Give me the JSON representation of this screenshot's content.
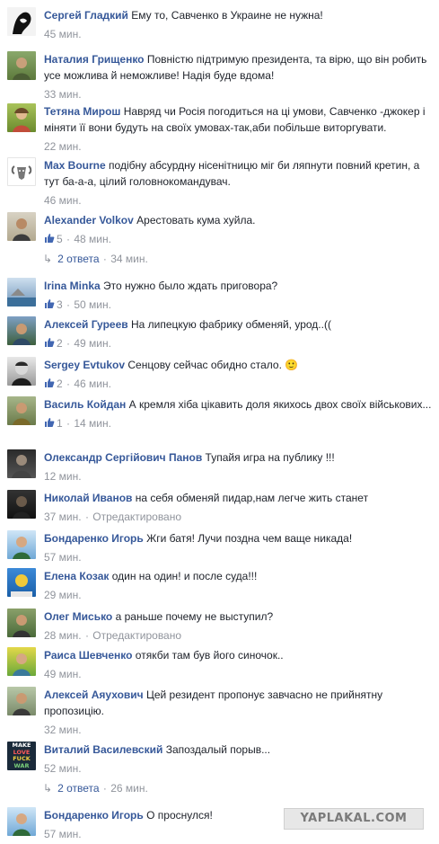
{
  "comments": [
    {
      "author": "Сергей Гладкий",
      "text": "Ему то, Савченко в Украине не нужна!",
      "time": "45 мин.",
      "likes": "",
      "edited": ""
    },
    {
      "author": "Наталия Грищенко",
      "text": "Повністю підтримую президента, та вірю, що він робить усе можлива й неможливе! Надія буде вдома!",
      "time": "33 мин.",
      "likes": "",
      "edited": ""
    },
    {
      "author": "Тетяна Мирош",
      "text": "Навряд чи Росія погодиться на ці умови, Савченко -джокер і міняти її вони будуть на своїх умовах-так,аби побільше виторгувати.",
      "time": "22 мин.",
      "likes": "",
      "edited": ""
    },
    {
      "author": "Max Bourne",
      "text": "подібну абсурдну нісенітницю міг би ляпнути повний кретин, а тут ба-а-а, цілий головнокомандувач.",
      "time": "46 мин.",
      "likes": "",
      "edited": ""
    },
    {
      "author": "Alexander Volkov",
      "text": "Арестовать кума хуйла.",
      "time": "48 мин.",
      "likes": "5",
      "edited": ""
    },
    {
      "author": "Irina Minka",
      "text": "Это нужно было ждать приговора?",
      "time": "50 мин.",
      "likes": "3",
      "edited": ""
    },
    {
      "author": "Алексей Гуреев",
      "text": "На липецкую фабрику обменяй, урод..((",
      "time": "49 мин.",
      "likes": "2",
      "edited": ""
    },
    {
      "author": "Sergey Evtukov",
      "text": "Сенцову сейчас обидно стало. 🙂",
      "time": "46 мин.",
      "likes": "2",
      "edited": ""
    },
    {
      "author": "Василь Койдан",
      "text": "А кремля хіба цікавить доля якихось двох своїх військових...",
      "time": "14 мин.",
      "likes": "1",
      "edited": ""
    },
    {
      "author": "Олександр Сергійович Панов",
      "text": "Тупайя игра на публику !!!",
      "time": "12 мин.",
      "likes": "",
      "edited": ""
    },
    {
      "author": "Николай Иванов",
      "text": "на себя обменяй пидар,нам легче жить станет",
      "time": "37 мин.",
      "likes": "",
      "edited": "Отредактировано"
    },
    {
      "author": "Бондаренко Игорь",
      "text": "Жги батя! Лучи поздна чем ваще никада!",
      "time": "57 мин.",
      "likes": "",
      "edited": ""
    },
    {
      "author": "Елена Козак",
      "text": "один на один! и после суда!!!",
      "time": "29 мин.",
      "likes": "",
      "edited": ""
    },
    {
      "author": "Олег Мисько",
      "text": "а раньше почему не выступил?",
      "time": "28 мин.",
      "likes": "",
      "edited": "Отредактировано"
    },
    {
      "author": "Раиса Шевченко",
      "text": "отякби там був його синочок..",
      "time": "49 мин.",
      "likes": "",
      "edited": ""
    },
    {
      "author": "Алексей Аяухович",
      "text": "Цей резидент пропонує завчасно не прийнятну пропозицію.",
      "time": "32 мин.",
      "likes": "",
      "edited": ""
    },
    {
      "author": "Виталий Василевский",
      "text": "Запоздалый порыв...",
      "time": "52 мин.",
      "likes": "",
      "edited": ""
    },
    {
      "author": "Бондаренко Игорь",
      "text": "О проснулся!",
      "time": "57 мин.",
      "likes": "",
      "edited": ""
    }
  ],
  "replies": [
    {
      "label": "2 ответа",
      "time": "34 мин."
    },
    {
      "label": "2 ответа",
      "time": "26 мин."
    }
  ],
  "separator": "·",
  "avatar_art": {
    "max_bourne_avatar": "ram-logo-icon",
    "vitaly_avatar_lines": [
      "MAKE",
      "LOVE",
      "FUCK",
      "WAR"
    ]
  },
  "watermark": "YAPLAKAL.COM",
  "colors": {
    "author": "#365899",
    "meta": "#90949c",
    "like": "#4267b2",
    "text": "#1d2129"
  }
}
